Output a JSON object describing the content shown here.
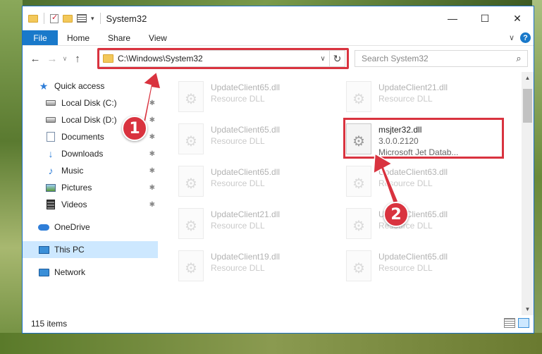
{
  "window": {
    "title": "System32",
    "min_label": "—",
    "max_label": "☐",
    "close_label": "✕"
  },
  "ribbon": {
    "tabs": [
      "File",
      "Home",
      "Share",
      "View"
    ],
    "collapse_label": "∨",
    "help_label": "?"
  },
  "nav": {
    "back": "←",
    "forward": "→",
    "recent": "∨",
    "up": "↑",
    "address": "C:\\Windows\\System32",
    "address_dropdown": "∨",
    "refresh": "↻",
    "search_placeholder": "Search System32",
    "search_glyph": "⌕"
  },
  "sidebar": {
    "quick_access": "Quick access",
    "items": [
      {
        "label": "Local Disk (C:)",
        "icon": "disk-icon"
      },
      {
        "label": "Local Disk (D:)",
        "icon": "disk-icon"
      },
      {
        "label": "Documents",
        "icon": "documents-icon"
      },
      {
        "label": "Downloads",
        "icon": "downloads-icon"
      },
      {
        "label": "Music",
        "icon": "music-icon"
      },
      {
        "label": "Pictures",
        "icon": "pictures-icon"
      },
      {
        "label": "Videos",
        "icon": "videos-icon"
      }
    ],
    "onedrive": "OneDrive",
    "this_pc": "This PC",
    "network": "Network",
    "pin_glyph": "📌"
  },
  "files": {
    "faded": [
      {
        "name": "UpdateClient65.dll",
        "type": "Resource DLL"
      },
      {
        "name": "UpdateClient21.dll",
        "type": "Resource DLL"
      },
      {
        "name": "UpdateClient65.dll",
        "type": "Resource DLL"
      },
      {
        "name": "UpdateClient65.dll",
        "type": "Resource DLL"
      },
      {
        "name": "UpdateClient63.dll",
        "type": "Resource DLL"
      },
      {
        "name": "UpdateClient21.dll",
        "type": "Resource DLL"
      },
      {
        "name": "UpdateClient65.dll",
        "type": "Resource DLL"
      },
      {
        "name": "UpdateClient19.dll",
        "type": "Resource DLL"
      },
      {
        "name": "UpdateClient65.dll",
        "type": "Resource DLL"
      }
    ],
    "highlighted": {
      "name": "msjter32.dll",
      "version": "3.0.0.2120",
      "description": "Microsoft Jet Datab..."
    }
  },
  "status": {
    "item_count": "115 items"
  },
  "annotations": {
    "callout_1": "1",
    "callout_2": "2",
    "color": "#d9333f"
  }
}
